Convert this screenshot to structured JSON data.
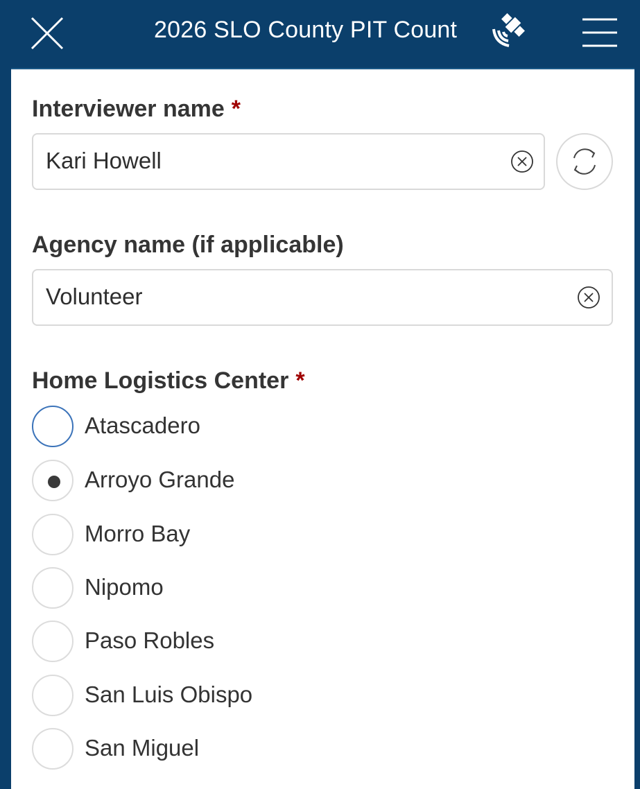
{
  "header": {
    "title": "2026 SLO County PIT Count",
    "close_icon": "close-icon",
    "gps_icon": "satellite-icon",
    "menu_icon": "hamburger-menu-icon"
  },
  "form": {
    "interviewer": {
      "label": "Interviewer name",
      "required_mark": "*",
      "value": "Kari Howell"
    },
    "agency": {
      "label": "Agency name (if applicable)",
      "value": "Volunteer"
    },
    "logistics": {
      "label": "Home Logistics Center",
      "required_mark": "*",
      "selected": "Arroyo Grande",
      "options": [
        {
          "label": "Atascadero"
        },
        {
          "label": "Arroyo Grande"
        },
        {
          "label": "Morro Bay"
        },
        {
          "label": "Nipomo"
        },
        {
          "label": "Paso Robles"
        },
        {
          "label": "San Luis Obispo"
        },
        {
          "label": "San Miguel"
        }
      ]
    }
  },
  "colors": {
    "header_bg": "#0b3f6b",
    "required": "#a00000",
    "focus_ring": "#3b73b9"
  }
}
